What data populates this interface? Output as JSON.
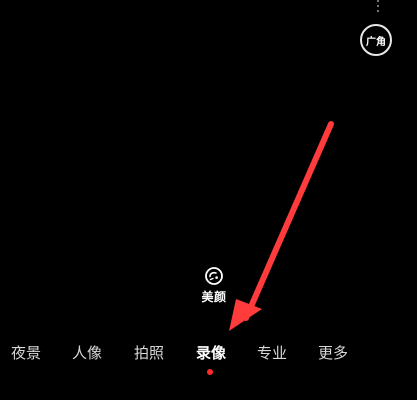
{
  "app": {
    "screen": "camera"
  },
  "top_controls": {
    "more_icon": "vertical-dots-icon",
    "wide_angle_label": "广角"
  },
  "beauty": {
    "icon": "beauty-face-icon",
    "label": "美颜"
  },
  "modes": [
    {
      "label": "夜景",
      "active": false
    },
    {
      "label": "人像",
      "active": false
    },
    {
      "label": "拍照",
      "active": false
    },
    {
      "label": "录像",
      "active": true
    },
    {
      "label": "专业",
      "active": false
    },
    {
      "label": "更多",
      "active": false
    }
  ],
  "annotation": {
    "type": "arrow",
    "color": "#ff3b3b",
    "points_to": "录像"
  },
  "colors": {
    "background": "#000000",
    "active_indicator": "#ff2b2b"
  }
}
